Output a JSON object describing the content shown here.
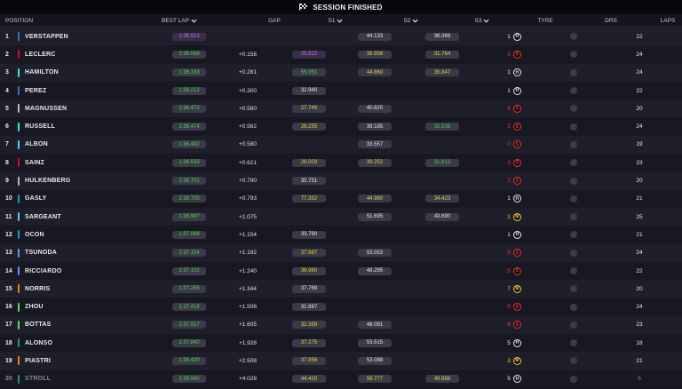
{
  "session": {
    "title": "SESSION FINISHED",
    "icon": "checkered-flag-icon"
  },
  "columns": {
    "position": "POSITION",
    "best_lap": "BEST LAP",
    "gap": "GAP",
    "s1": "S1",
    "s2": "S2",
    "s3": "S3",
    "tyre": "TYRE",
    "drs": "DRS",
    "laps": "LAPS"
  },
  "colors": {
    "green": "#4bd64b",
    "purple": "#c86cf0",
    "yellow": "#e6d23a",
    "soft": "#e8342e",
    "medium": "#f2d02c",
    "hard": "#ededed"
  },
  "rows": [
    {
      "pos": "1",
      "name": "VERSTAPPEN",
      "team_color": "#3671c6",
      "best": "1:35.913",
      "best_c": "p",
      "gap": "",
      "s1": "",
      "s1_c": "",
      "s2": "44.133",
      "s2_c": "w",
      "s3": "36.368",
      "s3_c": "w",
      "stint": "1",
      "tyre": "H",
      "laps": "22"
    },
    {
      "pos": "2",
      "name": "LECLERC",
      "team_color": "#e8002d",
      "best": "1:36.068",
      "best_c": "g",
      "gap": "+0.156",
      "s1": "25.822",
      "s1_c": "p",
      "s2": "38.958",
      "s2_c": "y",
      "s3": "31.764",
      "s3_c": "y",
      "stint": "5",
      "tyre": "S",
      "laps": "24"
    },
    {
      "pos": "3",
      "name": "HAMILTON",
      "team_color": "#27f4d2",
      "best": "1:36.193",
      "best_c": "g",
      "gap": "+0.281",
      "s1": "55.951",
      "s1_c": "g",
      "s2": "44.860",
      "s2_c": "y",
      "s3": "35.847",
      "s3_c": "y",
      "stint": "1",
      "tyre": "H",
      "laps": "24"
    },
    {
      "pos": "4",
      "name": "PEREZ",
      "team_color": "#3671c6",
      "best": "1:36.212",
      "best_c": "g",
      "gap": "+0.300",
      "s1": "32.940",
      "s1_c": "w",
      "s2": "",
      "s2_c": "",
      "s3": "",
      "s3_c": "",
      "stint": "1",
      "tyre": "H",
      "laps": "22"
    },
    {
      "pos": "5",
      "name": "MAGNUSSEN",
      "team_color": "#b6babd",
      "best": "1:36.472",
      "best_c": "g",
      "gap": "+0.560",
      "s1": "27.749",
      "s1_c": "y",
      "s2": "40.820",
      "s2_c": "w",
      "s3": "",
      "s3_c": "",
      "stint": "4",
      "tyre": "S",
      "laps": "20"
    },
    {
      "pos": "6",
      "name": "RUSSELL",
      "team_color": "#27f4d2",
      "best": "1:36.474",
      "best_c": "g",
      "gap": "+0.562",
      "s1": "26.255",
      "s1_c": "y",
      "s2": "39.185",
      "s2_c": "w",
      "s3": "31.535",
      "s3_c": "g",
      "stint": "2",
      "tyre": "S",
      "laps": "24"
    },
    {
      "pos": "7",
      "name": "ALBON",
      "team_color": "#64c4ff",
      "best": "1:36.492",
      "best_c": "g",
      "gap": "+0.580",
      "s1": "",
      "s1_c": "",
      "s2": "33.557",
      "s2_c": "w",
      "s3": "",
      "s3_c": "",
      "stint": "0",
      "tyre": "S",
      "laps": "19"
    },
    {
      "pos": "8",
      "name": "SAINZ",
      "team_color": "#e8002d",
      "best": "1:36.533",
      "best_c": "g",
      "gap": "+0.621",
      "s1": "26.003",
      "s1_c": "y",
      "s2": "39.252",
      "s2_c": "y",
      "s3": "31.813",
      "s3_c": "g",
      "stint": "3",
      "tyre": "S",
      "laps": "23"
    },
    {
      "pos": "9",
      "name": "HULKENBERG",
      "team_color": "#b6babd",
      "best": "1:36.702",
      "best_c": "g",
      "gap": "+0.790",
      "s1": "35.751",
      "s1_c": "w",
      "s2": "",
      "s2_c": "",
      "s3": "",
      "s3_c": "",
      "stint": "2",
      "tyre": "S",
      "laps": "20"
    },
    {
      "pos": "10",
      "name": "GASLY",
      "team_color": "#2293d1",
      "best": "1:36.705",
      "best_c": "g",
      "gap": "+0.793",
      "s1": "77.352",
      "s1_c": "y",
      "s2": "44.980",
      "s2_c": "y",
      "s3": "34.423",
      "s3_c": "y",
      "stint": "1",
      "tyre": "H",
      "laps": "21"
    },
    {
      "pos": "11",
      "name": "SARGEANT",
      "team_color": "#64c4ff",
      "best": "1:36.987",
      "best_c": "g",
      "gap": "+1.075",
      "s1": "",
      "s1_c": "",
      "s2": "51.695",
      "s2_c": "w",
      "s3": "43.690",
      "s3_c": "w",
      "stint": "1",
      "tyre": "M",
      "laps": "25"
    },
    {
      "pos": "12",
      "name": "OCON",
      "team_color": "#2293d1",
      "best": "1:37.066",
      "best_c": "g",
      "gap": "+1.154",
      "s1": "33.790",
      "s1_c": "w",
      "s2": "",
      "s2_c": "",
      "s3": "",
      "s3_c": "",
      "stint": "1",
      "tyre": "H",
      "laps": "21"
    },
    {
      "pos": "13",
      "name": "TSUNODA",
      "team_color": "#6692ff",
      "best": "1:37.104",
      "best_c": "g",
      "gap": "+1.192",
      "s1": "37.887",
      "s1_c": "y",
      "s2": "53.053",
      "s2_c": "w",
      "s3": "",
      "s3_c": "",
      "stint": "5",
      "tyre": "S",
      "laps": "24"
    },
    {
      "pos": "14",
      "name": "RICCIARDO",
      "team_color": "#6692ff",
      "best": "1:37.152",
      "best_c": "g",
      "gap": "+1.240",
      "s1": "36.980",
      "s1_c": "y",
      "s2": "48.295",
      "s2_c": "w",
      "s3": "",
      "s3_c": "",
      "stint": "5",
      "tyre": "S",
      "laps": "22"
    },
    {
      "pos": "15",
      "name": "NORRIS",
      "team_color": "#ff8000",
      "best": "1:37.256",
      "best_c": "g",
      "gap": "+1.344",
      "s1": "37.768",
      "s1_c": "w",
      "s2": "",
      "s2_c": "",
      "s3": "",
      "s3_c": "",
      "stint": "7",
      "tyre": "M",
      "laps": "20"
    },
    {
      "pos": "16",
      "name": "ZHOU",
      "team_color": "#52e252",
      "best": "1:37.418",
      "best_c": "g",
      "gap": "+1.506",
      "s1": "31.887",
      "s1_c": "w",
      "s2": "",
      "s2_c": "",
      "s3": "",
      "s3_c": "",
      "stint": "5",
      "tyre": "S",
      "laps": "24"
    },
    {
      "pos": "17",
      "name": "BOTTAS",
      "team_color": "#52e252",
      "best": "1:37.517",
      "best_c": "g",
      "gap": "+1.605",
      "s1": "32.359",
      "s1_c": "y",
      "s2": "48.091",
      "s2_c": "w",
      "s3": "",
      "s3_c": "",
      "stint": "6",
      "tyre": "S",
      "laps": "23"
    },
    {
      "pos": "18",
      "name": "ALONSO",
      "team_color": "#229971",
      "best": "1:37.840",
      "best_c": "g",
      "gap": "+1.928",
      "s1": "37.275",
      "s1_c": "y",
      "s2": "53.515",
      "s2_c": "w",
      "s3": "",
      "s3_c": "",
      "stint": "5",
      "tyre": "H",
      "laps": "18"
    },
    {
      "pos": "19",
      "name": "PIASTRI",
      "team_color": "#ff8000",
      "best": "1:38.420",
      "best_c": "g",
      "gap": "+2.508",
      "s1": "37.956",
      "s1_c": "y",
      "s2": "53.088",
      "s2_c": "w",
      "s3": "",
      "s3_c": "",
      "stint": "3",
      "tyre": "M",
      "laps": "21"
    },
    {
      "pos": "20",
      "name": "STROLL",
      "team_color": "#229971",
      "best": "1:39.940",
      "best_c": "g",
      "gap": "+4.028",
      "s1": "44.420",
      "s1_c": "y",
      "s2": "58.777",
      "s2_c": "y",
      "s3": "49.888",
      "s3_c": "y",
      "stint": "5",
      "tyre": "H",
      "laps": "5",
      "dim": true
    }
  ]
}
